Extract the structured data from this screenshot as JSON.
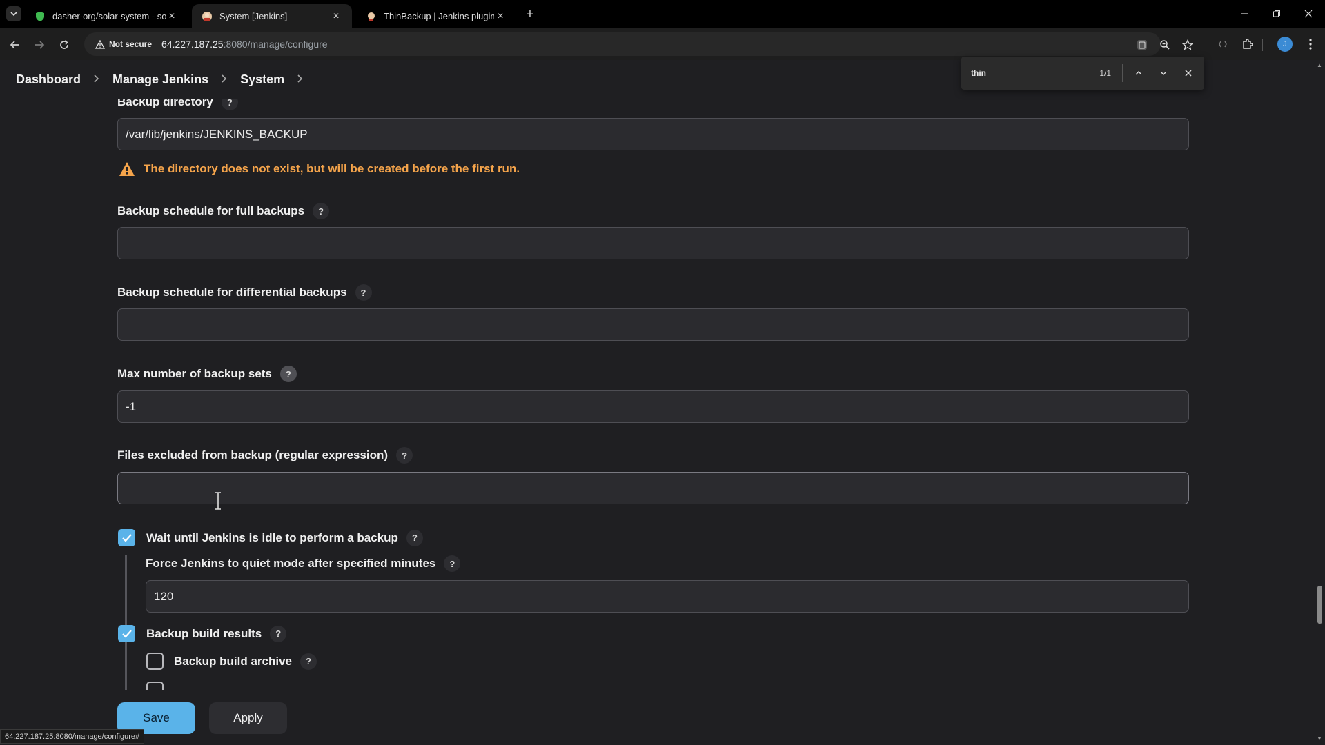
{
  "browser": {
    "tabs": [
      {
        "title": "dasher-org/solar-system - sola",
        "active": false
      },
      {
        "title": "System [Jenkins]",
        "active": true
      },
      {
        "title": "ThinBackup | Jenkins plugin",
        "active": false
      }
    ],
    "security_label": "Not secure",
    "url_host": "64.227.187.25",
    "url_rest": ":8080/manage/configure",
    "profile_initial": "J",
    "find": {
      "query": "thin",
      "count": "1/1"
    },
    "status_url": "64.227.187.25:8080/manage/configure#"
  },
  "breadcrumbs": [
    "Dashboard",
    "Manage Jenkins",
    "System"
  ],
  "form": {
    "backup_directory": {
      "label": "Backup directory",
      "value": "/var/lib/jenkins/JENKINS_BACKUP",
      "warning": "The directory does not exist, but will be created before the first run."
    },
    "full_schedule": {
      "label": "Backup schedule for full backups",
      "value": ""
    },
    "diff_schedule": {
      "label": "Backup schedule for differential backups",
      "value": ""
    },
    "max_sets": {
      "label": "Max number of backup sets",
      "value": "-1"
    },
    "excluded": {
      "label": "Files excluded from backup (regular expression)",
      "value": ""
    },
    "wait_idle": {
      "label": "Wait until Jenkins is idle to perform a backup",
      "checked": true
    },
    "force_quiet": {
      "label": "Force Jenkins to quiet mode after specified minutes",
      "value": "120"
    },
    "build_results": {
      "label": "Backup build results",
      "checked": true
    },
    "build_archive": {
      "label": "Backup build archive",
      "checked": false
    }
  },
  "help_glyph": "?",
  "buttons": {
    "save": "Save",
    "apply": "Apply"
  },
  "colors": {
    "accent": "#5ab3e9",
    "warning": "#f5a44b",
    "background": "#1f1f22"
  }
}
